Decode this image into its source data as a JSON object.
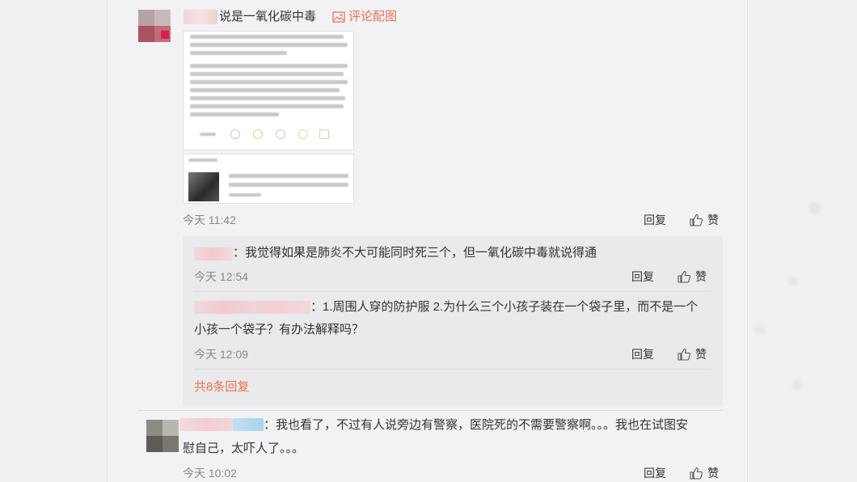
{
  "comment1": {
    "suffix_text": "说是一氧化碳中毒",
    "image_link_label": "评论配图",
    "time": "今天 11:42",
    "reply_label": "回复",
    "like_label": "赞"
  },
  "replies": [
    {
      "text": "：我觉得如果是肺炎不大可能同时死三个，但一氧化碳中毒就说得通",
      "time": "今天 12:54",
      "reply_label": "回复",
      "like_label": "赞"
    },
    {
      "text_line1": "：1.周围人穿的防护服 2.为什么三个小孩子装在一个袋子里，而不是一个",
      "text_line2": "小孩一个袋子？有办法解释吗？",
      "time": "今天 12:09",
      "reply_label": "回复",
      "like_label": "赞"
    }
  ],
  "more_replies_label": "共8条回复",
  "comment2": {
    "text_line1": "：我也看了，不过有人说旁边有警察，医院死的不需要警察啊。。。我也在试图安",
    "text_line2": "慰自己，太吓人了。。。",
    "time": "今天 10:02",
    "reply_label": "回复",
    "like_label": "赞"
  },
  "icons": {
    "image_link": "image-icon",
    "like": "thumbs-up-icon"
  },
  "colors": {
    "accent_orange": "#eb7350",
    "panel_bg": "#f2f2f5",
    "reply_bg": "#eaeaec"
  }
}
